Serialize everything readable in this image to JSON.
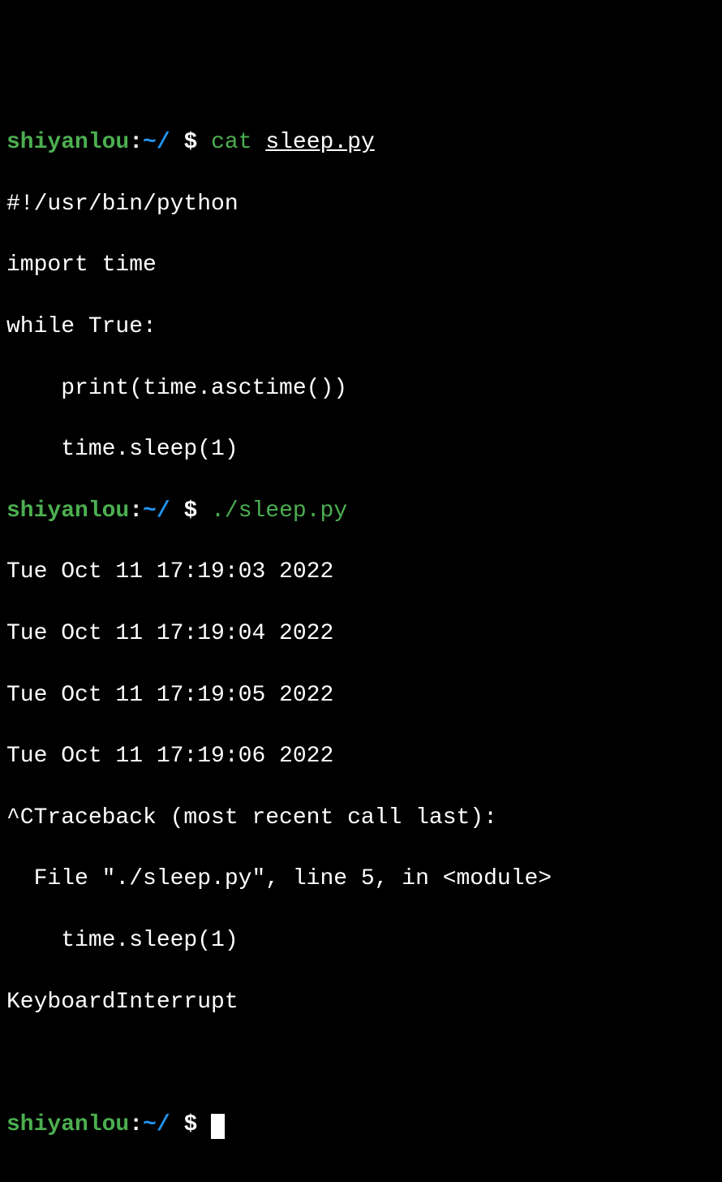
{
  "prompt": {
    "user": "shiyanlou",
    "separator": ":",
    "path": "~/",
    "dollar": "$"
  },
  "lines": {
    "cmd1": {
      "command": "cat",
      "arg": "sleep.py"
    },
    "script_line1": "#!/usr/bin/python",
    "script_line2": "import time",
    "script_line3": "while True:",
    "script_line4": "    print(time.asctime())",
    "script_line5": "    time.sleep(1)",
    "cmd2": {
      "command": "./sleep.py"
    },
    "output1": "Tue Oct 11 17:19:03 2022",
    "output2": "Tue Oct 11 17:19:04 2022",
    "output3": "Tue Oct 11 17:19:05 2022",
    "output4": "Tue Oct 11 17:19:06 2022",
    "traceback1": "^CTraceback (most recent call last):",
    "traceback2": "  File \"./sleep.py\", line 5, in <module>",
    "traceback3": "    time.sleep(1)",
    "traceback4": "KeyboardInterrupt"
  }
}
